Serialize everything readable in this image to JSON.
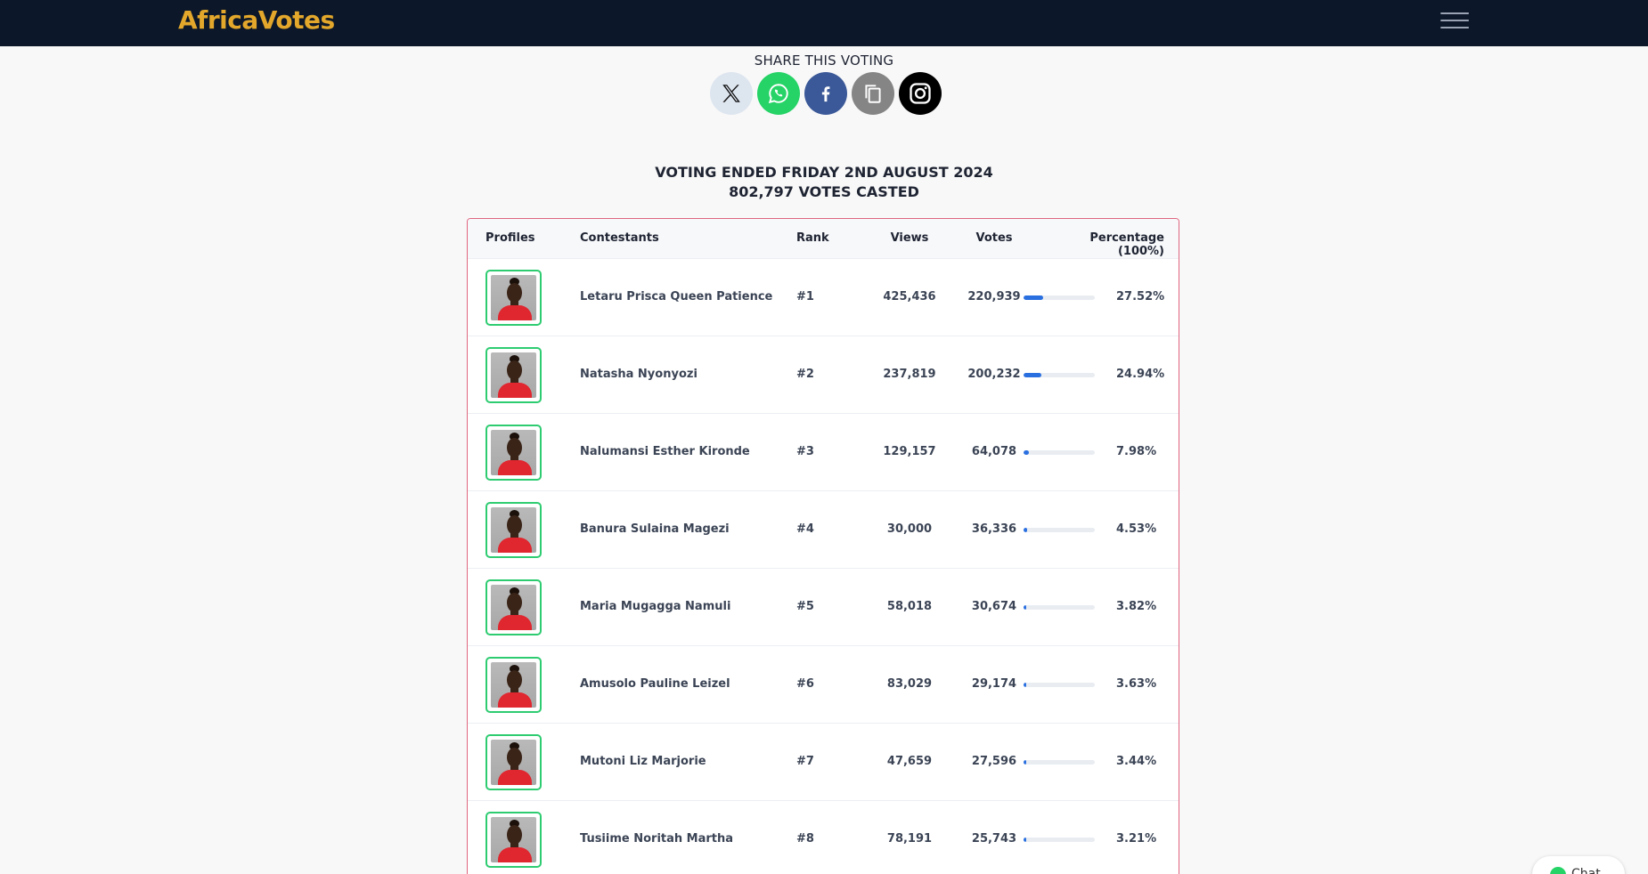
{
  "navbar": {
    "brand": "AfricaVotes",
    "menu_icon": "hamburger-menu-icon"
  },
  "share": {
    "title": "SHARE THIS VOTING",
    "buttons": [
      {
        "name": "x-share-button",
        "icon": "x-logo-icon",
        "color": "#dde5ef"
      },
      {
        "name": "whatsapp-share-button",
        "icon": "whatsapp-icon",
        "color": "#25d366"
      },
      {
        "name": "facebook-share-button",
        "icon": "facebook-icon",
        "color": "#3b5998"
      },
      {
        "name": "copy-link-button",
        "icon": "copy-icon",
        "color": "#858585"
      },
      {
        "name": "instagram-share-button",
        "icon": "instagram-icon",
        "color": "#000000"
      }
    ]
  },
  "status": {
    "ended": "VOTING ENDED FRIDAY 2ND AUGUST 2024",
    "total": "802,797 VOTES CASTED"
  },
  "table": {
    "headers": {
      "profiles": "Profiles",
      "contestants": "Contestants",
      "rank": "Rank",
      "views": "Views",
      "votes": "Votes",
      "percentage": "Percentage (100%)"
    },
    "rows": [
      {
        "name": "Letaru Prisca Queen Patience",
        "rank": "#1",
        "views": "425,436",
        "votes": "220,939",
        "pct": "27.52%",
        "bar_percent": 27.52
      },
      {
        "name": "Natasha Nyonyozi",
        "rank": "#2",
        "views": "237,819",
        "votes": "200,232",
        "pct": "24.94%",
        "bar_percent": 24.94
      },
      {
        "name": "Nalumansi Esther Kironde",
        "rank": "#3",
        "views": "129,157",
        "votes": "64,078",
        "pct": "7.98%",
        "bar_percent": 7.98
      },
      {
        "name": "Banura Sulaina Magezi",
        "rank": "#4",
        "views": "30,000",
        "votes": "36,336",
        "pct": "4.53%",
        "bar_percent": 4.53
      },
      {
        "name": "Maria Mugagga Namuli",
        "rank": "#5",
        "views": "58,018",
        "votes": "30,674",
        "pct": "3.82%",
        "bar_percent": 3.82
      },
      {
        "name": "Amusolo Pauline Leizel",
        "rank": "#6",
        "views": "83,029",
        "votes": "29,174",
        "pct": "3.63%",
        "bar_percent": 3.63
      },
      {
        "name": "Mutoni Liz Marjorie",
        "rank": "#7",
        "views": "47,659",
        "votes": "27,596",
        "pct": "3.44%",
        "bar_percent": 3.44
      },
      {
        "name": "Tusiime Noritah Martha",
        "rank": "#8",
        "views": "78,191",
        "votes": "25,743",
        "pct": "3.21%",
        "bar_percent": 3.21
      }
    ]
  },
  "chat": {
    "label": "Chat",
    "icon": "whatsapp-icon"
  },
  "colors": {
    "navbar": "#0c1729",
    "brand": "#e2a72b",
    "accent": "#2a6fe0",
    "photo_border": "#2ecc71",
    "card_border": "#e06680"
  }
}
